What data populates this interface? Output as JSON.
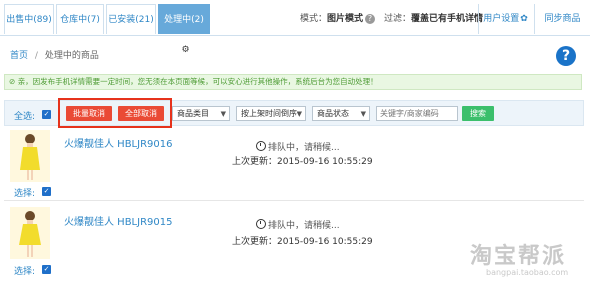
{
  "tabs": [
    {
      "label": "出售中(89)"
    },
    {
      "label": "仓库中(7)"
    },
    {
      "label": "已安装(21)"
    },
    {
      "label": "处理中(2)"
    }
  ],
  "mode": {
    "label": "模式：",
    "value": "图片模式"
  },
  "filter": {
    "label": "过滤：",
    "value": "覆盖已有手机详情"
  },
  "top_buttons": {
    "user_settings": "用户设置",
    "sync": "同步商品"
  },
  "breadcrumb": {
    "home": "首页",
    "separator": "/",
    "current": "处理中的商品"
  },
  "notice": "亲，因发布手机详情需要一定时间，您无须在本页面等候，可以安心进行其他操作，系统后台为您自动处理！",
  "toolbar": {
    "select_all": "全选:",
    "batch_cancel": "批量取消",
    "cancel_all": "全部取消",
    "category": "商品类目",
    "sort": "按上架时间倒序",
    "status": "商品状态",
    "search_placeholder": "关键字/商家编码",
    "search_button": "搜索"
  },
  "products": [
    {
      "title": "火爆靓佳人 HBLJR9016",
      "status": "排队中，请稍候...",
      "update_label": "上次更新：",
      "update_time": "2015-09-16 10:55:29",
      "select_label": "选择:"
    },
    {
      "title": "火爆靓佳人 HBLJR9015",
      "status": "排队中，请稍候...",
      "update_label": "上次更新：",
      "update_time": "2015-09-16 10:55:29",
      "select_label": "选择:"
    }
  ],
  "watermark": {
    "text": "淘宝帮派",
    "url": "bangpai.taobao.com"
  },
  "colors": {
    "accent": "#67a9da",
    "link": "#2f87c6",
    "danger": "#ea4a35",
    "success": "#3bbf6c",
    "notice_bg": "#e9f7e2"
  }
}
